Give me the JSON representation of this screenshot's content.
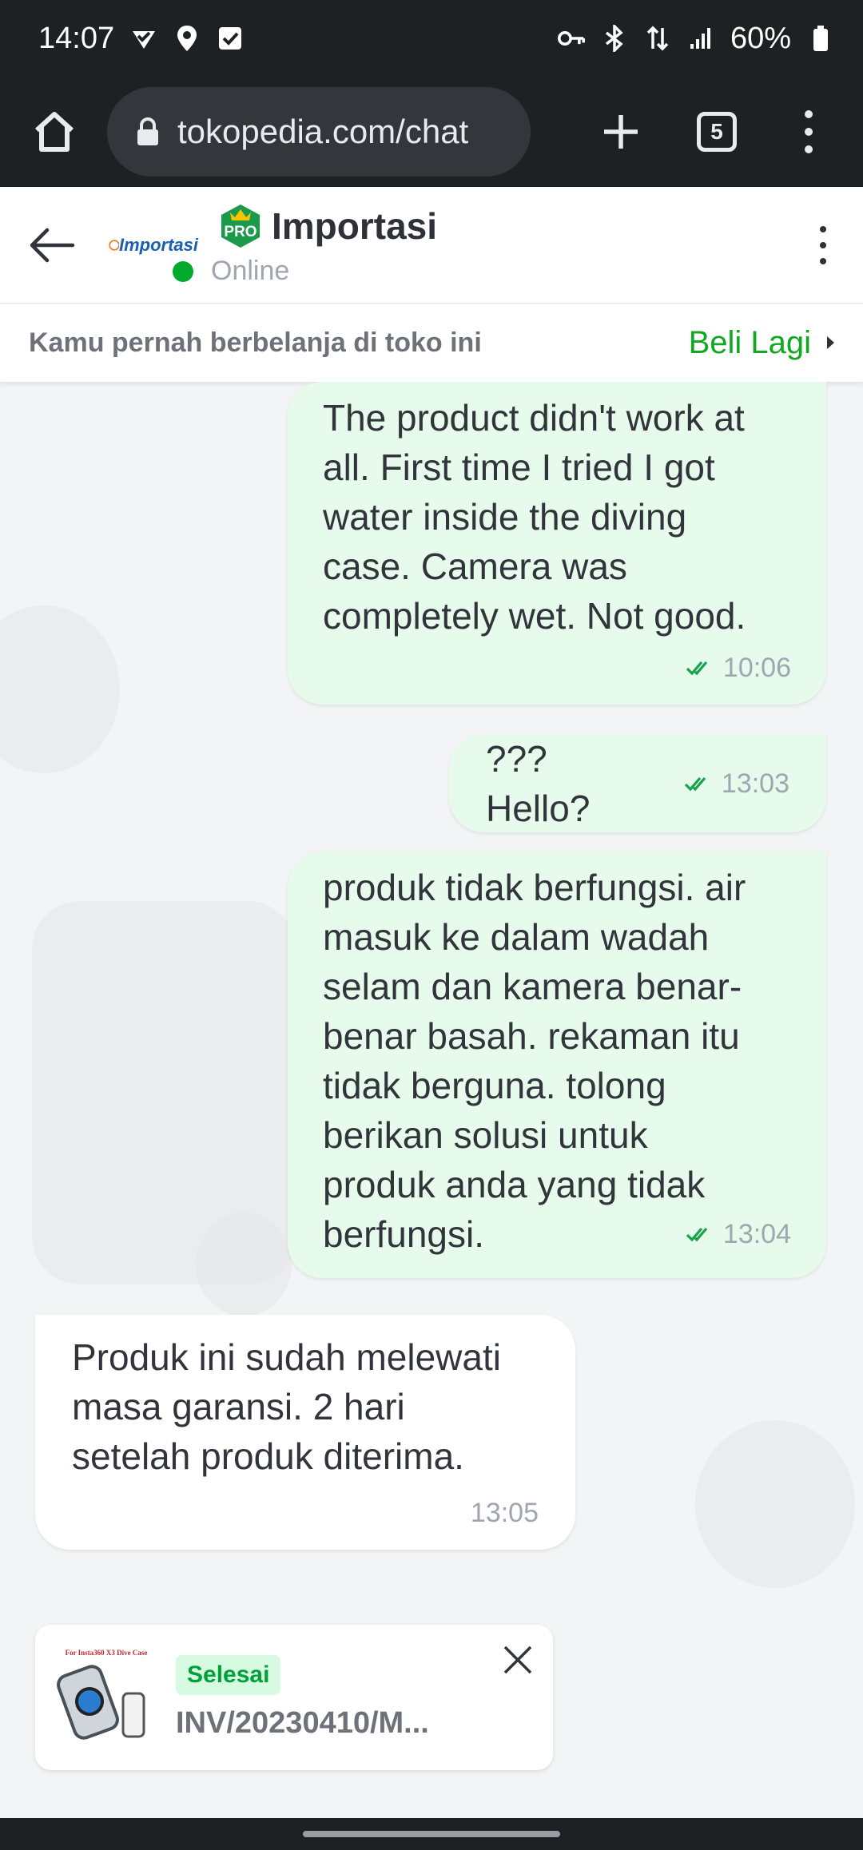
{
  "status_bar": {
    "time": "14:07",
    "battery": "60%"
  },
  "browser": {
    "url": "tokopedia.com/chat",
    "tab_count": "5"
  },
  "chat_header": {
    "shop_logo_text": "Importasi",
    "pro_badge": "PRO",
    "shop_name": "Importasi",
    "status": "Online"
  },
  "info_strip": {
    "text": "Kamu pernah berbelanja di toko ini",
    "action": "Beli Lagi"
  },
  "messages": [
    {
      "direction": "out",
      "lines": [
        "The product didn't work at",
        "all. First time I tried I got",
        "water inside the diving",
        "case. Camera was",
        "completely wet. Not good."
      ],
      "time": "10:06",
      "read": true
    },
    {
      "direction": "out",
      "lines": [
        "??? Hello?"
      ],
      "time": "13:03",
      "read": true
    },
    {
      "direction": "out",
      "lines": [
        "produk tidak berfungsi. air",
        "masuk ke dalam wadah",
        "selam dan kamera benar-",
        "benar basah. rekaman itu",
        "tidak berguna. tolong",
        "berikan solusi untuk",
        "produk anda yang tidak",
        "berfungsi."
      ],
      "time": "13:04",
      "read": true
    },
    {
      "direction": "in",
      "lines": [
        "Produk ini sudah melewati",
        "masa garansi. 2 hari",
        "setelah produk diterima."
      ],
      "time": "13:05",
      "read": false
    }
  ],
  "product_card": {
    "thumb_caption": "For Insta360 X3 Dive Case",
    "status": "Selesai",
    "invoice": "INV/20230410/M..."
  },
  "colors": {
    "accent_green": "#10a820",
    "outgoing_bubble": "#e6fbeb",
    "dark_bar": "#1e2124"
  },
  "icons": {
    "home": "home-icon",
    "lock": "lock-icon",
    "back": "arrow-left-icon",
    "close": "close-icon",
    "read": "double-check-icon"
  }
}
